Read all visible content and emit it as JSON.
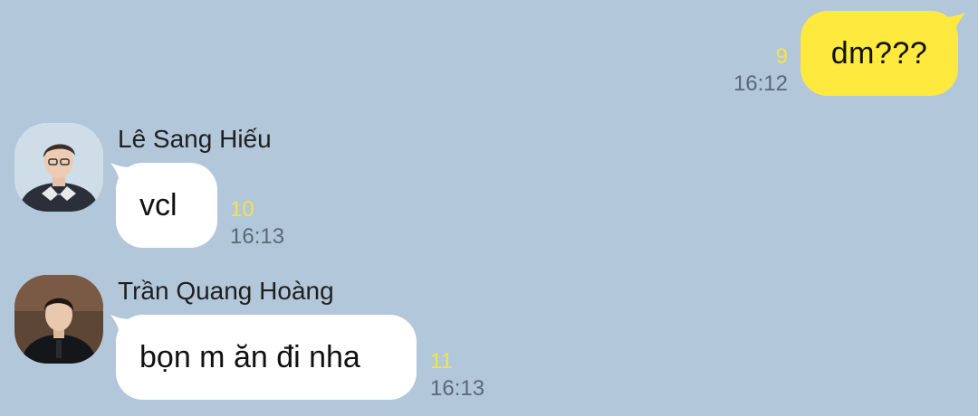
{
  "colors": {
    "background": "#b2c7da",
    "outgoing_bubble": "#fee93f",
    "incoming_bubble": "#ffffff",
    "unread_count": "#f6e14a",
    "timestamp": "#596978"
  },
  "messages": [
    {
      "direction": "outgoing",
      "text": "dm???",
      "unread_count": "9",
      "time": "16:12"
    },
    {
      "direction": "incoming",
      "sender": "Lê Sang Hiếu",
      "avatar_icon": "user-avatar-icon",
      "text": "vcl",
      "unread_count": "10",
      "time": "16:13"
    },
    {
      "direction": "incoming",
      "sender": "Trần Quang Hoàng",
      "avatar_icon": "user-avatar-icon",
      "text": "bọn m ăn đi nha",
      "unread_count": "11",
      "time": "16:13"
    }
  ]
}
